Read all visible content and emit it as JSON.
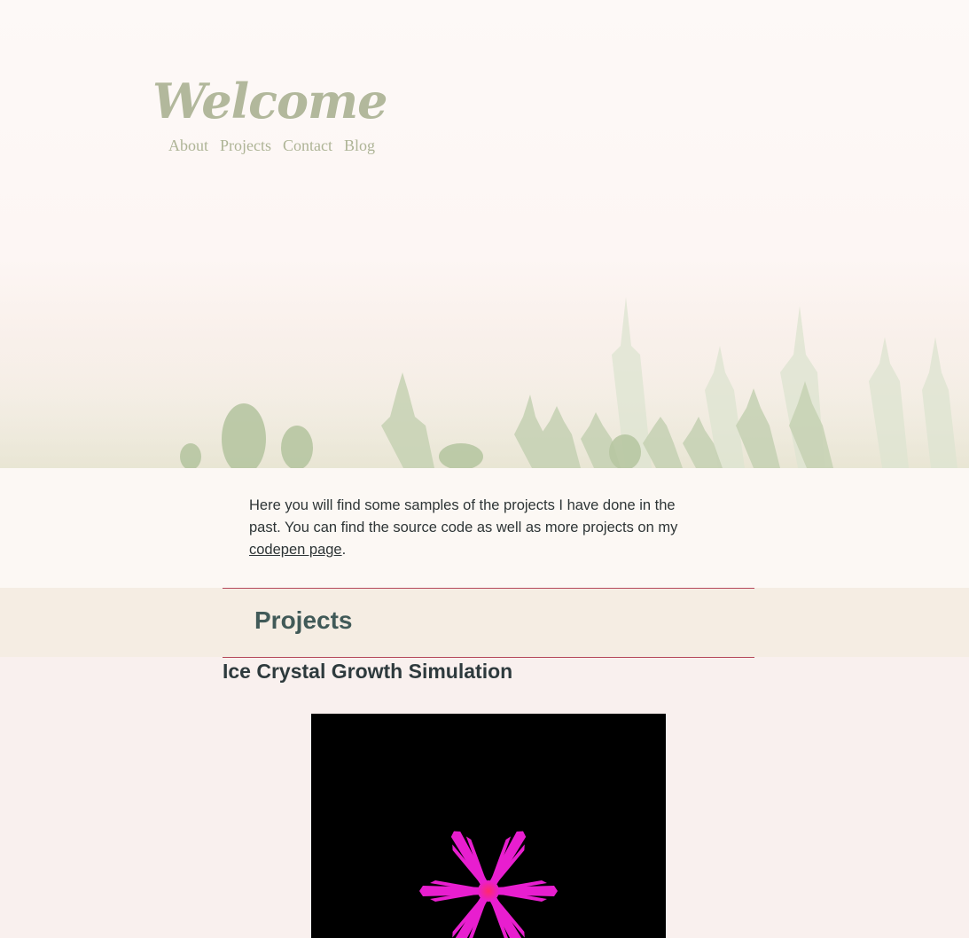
{
  "header": {
    "title": "Welcome",
    "nav": [
      "About",
      "Projects",
      "Contact",
      "Blog"
    ]
  },
  "intro": {
    "text_before_link": "Here you will find some samples of the projects I have done in the past. You can find the source code as well as more projects on my ",
    "link_text": "codepen page",
    "text_after_link": "."
  },
  "projects": {
    "heading": "Projects",
    "items": [
      {
        "title": "Ice Crystal Growth Simulation"
      }
    ]
  },
  "colors": {
    "title": "#b2b89c",
    "nav": "#aeb496",
    "rule": "#b5485a",
    "projects_heading": "#415a58",
    "crystal": "#e81ecf"
  }
}
